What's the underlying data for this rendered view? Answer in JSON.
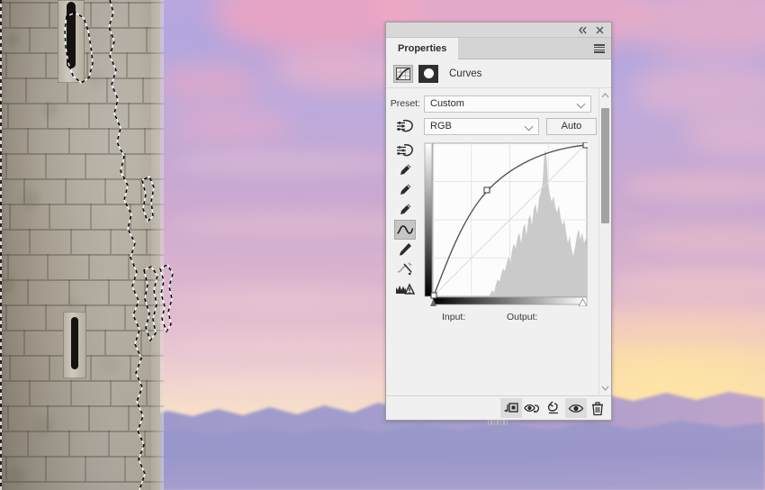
{
  "app": {
    "document_background": "sunset-sky-with-stone-tower-photo",
    "selection_state": "active-marching-ants-selection"
  },
  "panel": {
    "titlebar": {
      "collapse_icon": "double-chevron-left-icon",
      "collapse_glyph": "«",
      "close_icon": "close-x-icon",
      "close_glyph": "✕"
    },
    "tabs": [
      {
        "label": "Properties",
        "active": true
      }
    ],
    "menu_icon": "panel-menu-hamburger-icon",
    "adjustment": {
      "icon": "curves-adjustment-icon",
      "mask_icon": "layer-mask-thumbnail-icon",
      "title": "Curves"
    },
    "preset": {
      "label": "Preset:",
      "value": "Custom",
      "caret_icon": "chevron-down-icon"
    },
    "channel": {
      "target_icon": "on-image-adjustment-target-icon",
      "value": "RGB",
      "caret_icon": "chevron-down-icon",
      "auto_label": "Auto"
    },
    "tools": [
      {
        "name": "on-image-adjust-icon",
        "label": "Click and drag in image to modify curve",
        "active": false
      },
      {
        "name": "black-point-eyedropper-icon",
        "label": "Sample in image to set black point",
        "active": false
      },
      {
        "name": "gray-point-eyedropper-icon",
        "label": "Sample in image to set gray point",
        "active": false
      },
      {
        "name": "white-point-eyedropper-icon",
        "label": "Sample in image to set white point",
        "active": false
      },
      {
        "name": "curve-point-tool-icon",
        "label": "Edit points to modify the curve",
        "active": true
      },
      {
        "name": "pencil-draw-curve-icon",
        "label": "Draw to modify the curve",
        "active": false
      },
      {
        "name": "smooth-curve-values-icon",
        "label": "Smooth the curve values",
        "active": false
      },
      {
        "name": "clipping-warning-icon",
        "label": "Show clipping for black/white points",
        "active": false
      }
    ],
    "graph_labels": {
      "input": "Input:",
      "output": "Output:"
    },
    "scrollbar": {
      "up_icon": "chevron-up-icon",
      "down_icon": "chevron-down-icon",
      "thumb_position_percent": 6
    },
    "footer_buttons": [
      {
        "name": "clip-to-layer-button",
        "icon": "clip-to-layer-icon",
        "pressed": true
      },
      {
        "name": "toggle-layer-mask-button",
        "icon": "eye-with-arrow-icon",
        "pressed": false
      },
      {
        "name": "reset-adjustment-button",
        "icon": "reset-arrow-icon",
        "pressed": false
      },
      {
        "name": "toggle-layer-visibility-button",
        "icon": "eye-icon",
        "pressed": true
      },
      {
        "name": "delete-adjustment-layer-button",
        "icon": "trash-can-icon",
        "pressed": false
      }
    ],
    "resize_grip": "panel-resize-grip"
  },
  "chart_data": {
    "type": "line",
    "title": "Curves tone curve (RGB composite)",
    "xlabel": "Input",
    "ylabel": "Output",
    "xlim": [
      0,
      255
    ],
    "ylim": [
      0,
      255
    ],
    "grid": true,
    "grid_divisions": 4,
    "legend_position": "none",
    "baseline": {
      "name": "Identity (1:1) reference line",
      "x": [
        0,
        255
      ],
      "y": [
        0,
        255
      ],
      "style": "thin diagonal"
    },
    "series": [
      {
        "name": "RGB curve",
        "color": "#555555",
        "x": [
          0,
          32,
          64,
          96,
          128,
          160,
          192,
          224,
          255
        ],
        "y": [
          0,
          60,
          112,
          152,
          183,
          207,
          226,
          242,
          255
        ]
      }
    ],
    "control_points": [
      {
        "name": "black-point-node",
        "input": 0,
        "output": 0
      },
      {
        "name": "midtone-node",
        "input": 105,
        "output": 183
      },
      {
        "name": "white-point-node",
        "input": 255,
        "output": 255
      }
    ],
    "histogram": {
      "name": "Image luminance histogram",
      "color": "#c9c9c9",
      "bins": 64,
      "values": [
        0,
        0,
        0,
        0,
        0,
        0,
        0,
        0,
        0,
        0,
        0,
        0,
        0,
        0,
        0,
        0,
        0,
        0,
        1,
        2,
        2,
        3,
        4,
        4,
        5,
        6,
        8,
        12,
        16,
        18,
        22,
        20,
        24,
        28,
        26,
        30,
        34,
        32,
        38,
        42,
        40,
        48,
        46,
        54,
        58,
        52,
        62,
        66,
        74,
        70,
        86,
        96,
        78,
        92,
        100,
        64,
        52,
        44,
        40,
        36,
        32,
        48,
        44,
        30
      ],
      "peak_bin": 51,
      "peak_value": 100
    },
    "shadow_slider": {
      "name": "black-point-slider",
      "position": 0,
      "handle": "filled-triangle"
    },
    "highlight_slider": {
      "name": "white-point-slider",
      "position": 255,
      "handle": "hollow-triangle"
    },
    "input_gradient": "black-to-white horizontal ramp along x axis",
    "output_gradient": "black-to-white vertical ramp along y axis"
  },
  "colors": {
    "panel_bg": "#f0f0f0",
    "panel_border": "#9e9e9e",
    "tab_strip": "#d4d4d4",
    "titlebar": "#d8d8d8",
    "curve_stroke": "#555555",
    "histogram_fill": "#c9c9c9",
    "graph_bg": "#fcfcfc",
    "grid_line": "#e4e4e4",
    "sky_top": "#b3a6df",
    "sky_mid": "#cfaccf",
    "sky_glow": "#ffe89e",
    "mountain": "#8e8cc4",
    "stone_light": "#cfcabe",
    "stone_dark": "#15130f"
  }
}
